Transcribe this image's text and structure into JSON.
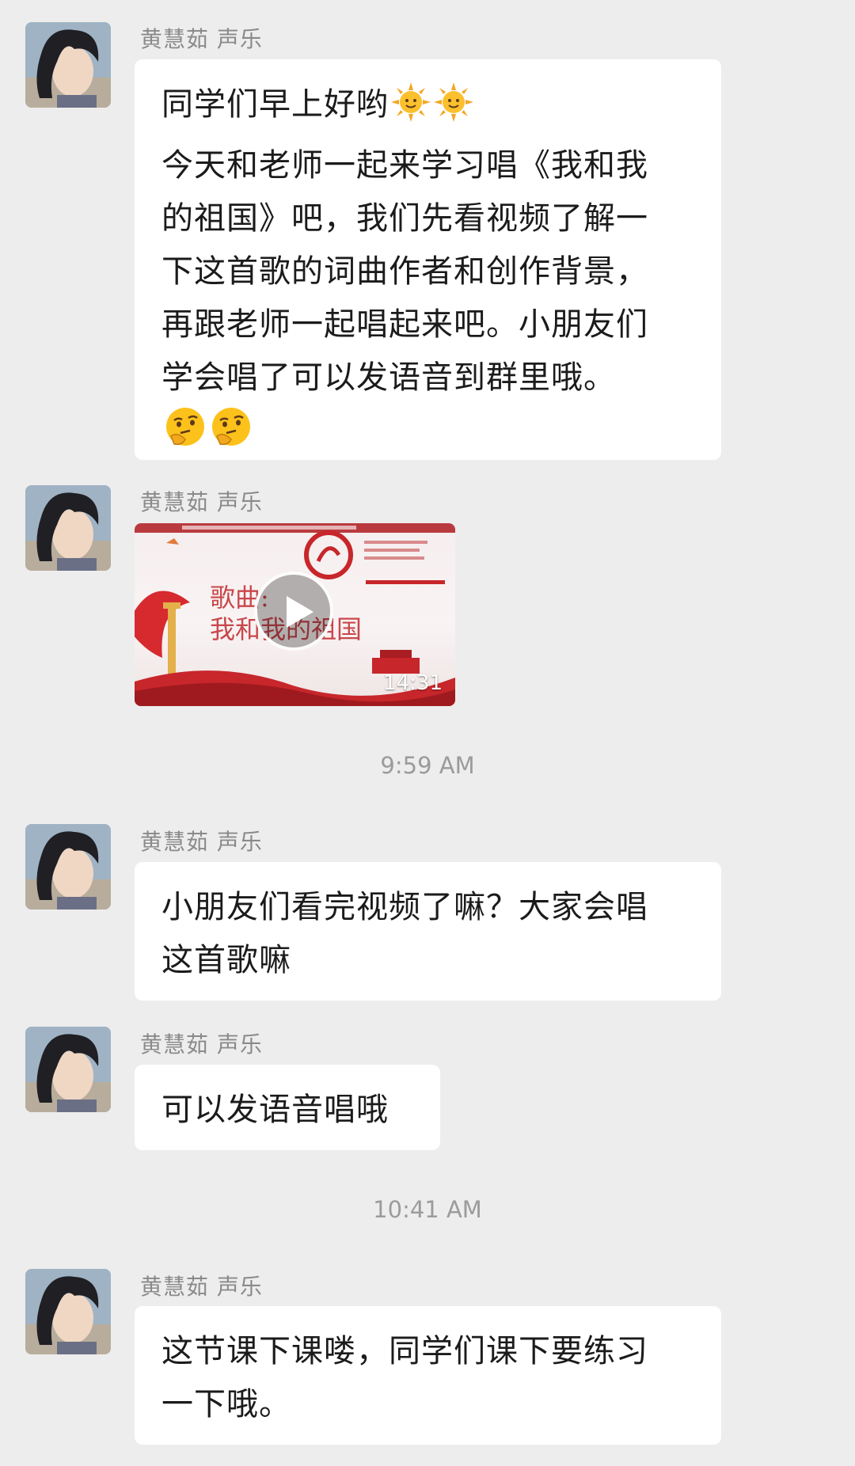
{
  "sender_name": "黄慧茹 声乐",
  "messages": [
    {
      "type": "text",
      "lines": [
        "同学们早上好哟",
        "今天和老师一起来学习唱《我和我",
        "的祖国》吧，我们先看视频了解一",
        "下这首歌的词曲作者和创作背景，",
        "再跟老师一起唱起来吧。小朋友们",
        "学会唱了可以发语音到群里哦。"
      ],
      "emojis_line1": [
        "sun-emoji",
        "sun-emoji"
      ],
      "emojis_last": [
        "thinking-face-emoji",
        "thinking-face-emoji"
      ]
    },
    {
      "type": "video",
      "video_title_line1": "歌曲:",
      "video_title_line2": "我和我的祖国",
      "duration": "14:31"
    },
    {
      "type": "timestamp",
      "text": "9:59 AM"
    },
    {
      "type": "text",
      "lines": [
        "小朋友们看完视频了嘛？大家会唱",
        "这首歌嘛"
      ]
    },
    {
      "type": "text",
      "lines": [
        "可以发语音唱哦"
      ]
    },
    {
      "type": "timestamp",
      "text": "10:41 AM"
    },
    {
      "type": "text",
      "lines": [
        "这节课下课喽，同学们课下要练习",
        "一下哦。"
      ]
    }
  ],
  "colors": {
    "background": "#ededed",
    "bubble": "#ffffff",
    "text": "#1b1b1b",
    "meta_text": "#8a8a8a",
    "video_red": "#c9474c"
  }
}
